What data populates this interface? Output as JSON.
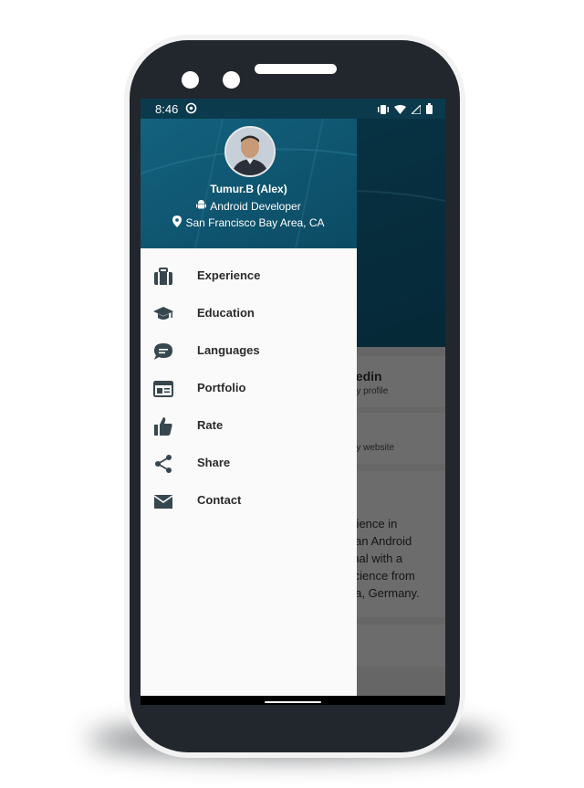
{
  "status_bar": {
    "time": "8:46"
  },
  "drawer": {
    "profile": {
      "name": "Tumur.B (Alex)",
      "title": "Android Developer",
      "location": "San Francisco Bay Area, CA"
    },
    "items": [
      {
        "label": "Experience",
        "icon": "briefcase-icon"
      },
      {
        "label": "Education",
        "icon": "graduation-cap-icon"
      },
      {
        "label": "Languages",
        "icon": "chat-bubble-icon"
      },
      {
        "label": "Portfolio",
        "icon": "web-window-icon"
      },
      {
        "label": "Rate",
        "icon": "thumbs-up-icon"
      },
      {
        "label": "Share",
        "icon": "share-icon"
      },
      {
        "label": "Contact",
        "icon": "mail-icon"
      }
    ]
  },
  "background_app": {
    "cards": [
      {
        "title": "kedin",
        "subtitle": "my profile"
      },
      {
        "title": "b",
        "subtitle": "my website"
      }
    ],
    "bio_lines": [
      "erience in",
      "s an Android",
      "onal with a",
      "Science from",
      "ida, Germany."
    ]
  },
  "colors": {
    "header": "#0f5570",
    "drawer_bg": "#fafafa",
    "phone": "#21272d"
  }
}
